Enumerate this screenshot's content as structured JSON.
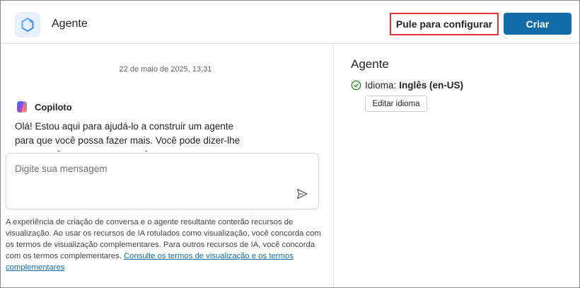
{
  "header": {
    "title": "Agente",
    "skip_to_configure_label": "Pule para configurar",
    "create_label": "Criar"
  },
  "chat": {
    "timestamp": "22 de maio de 2025, 13:31",
    "sender": "Copiloto",
    "message": "Olá! Estou aqui para ajudá-lo a construir um agente para que você possa fazer mais. Você pode dizer-lhe o que você quer que o agente faça."
  },
  "composer": {
    "placeholder": "Digite sua mensagem",
    "value": ""
  },
  "disclaimer": {
    "text": "A experiência de criação de conversa e o agente resultante conterão recursos de visualização. Ao usar os recursos de IA rotulados como visualização, você concorda com os termos de visualização complementares. Para outros recursos de IA, você concorda com os termos complementares. ",
    "link_text": "Consulte os termos de visualização e os termos complementares"
  },
  "details": {
    "title": "Agente",
    "language_label": "Idioma:",
    "language_value": "Inglês (en-US)",
    "edit_language_label": "Editar idioma"
  },
  "colors": {
    "primary": "#136ba8",
    "highlight_border": "#e0353b",
    "success": "#107c10"
  },
  "icons": {
    "agent_logo": "agent-hexagon-icon",
    "copilot": "copilot-icon",
    "send": "send-icon",
    "language_status": "check-circle-icon"
  }
}
